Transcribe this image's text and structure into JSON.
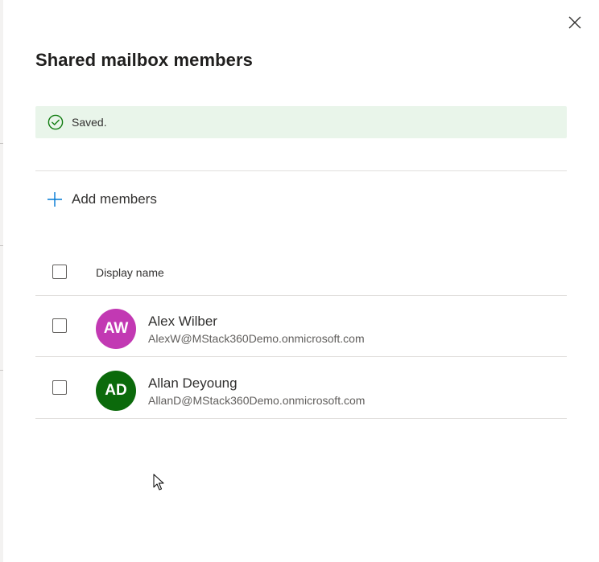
{
  "panel": {
    "title": "Shared mailbox members",
    "close_icon": "close-icon"
  },
  "status": {
    "icon": "checkmark-circle-icon",
    "message": "Saved.",
    "color": "#107c10",
    "background": "#e9f5ea"
  },
  "actions": {
    "add_label": "Add members",
    "add_icon": "plus-icon",
    "accent": "#0078d4"
  },
  "table": {
    "header": "Display name",
    "rows": [
      {
        "initials": "AW",
        "name": "Alex Wilber",
        "email": "AlexW@MStack360Demo.onmicrosoft.com",
        "avatar_color": "#c239b3"
      },
      {
        "initials": "AD",
        "name": "Allan Deyoung",
        "email": "AllanD@MStack360Demo.onmicrosoft.com",
        "avatar_color": "#0b6a0b"
      }
    ]
  }
}
